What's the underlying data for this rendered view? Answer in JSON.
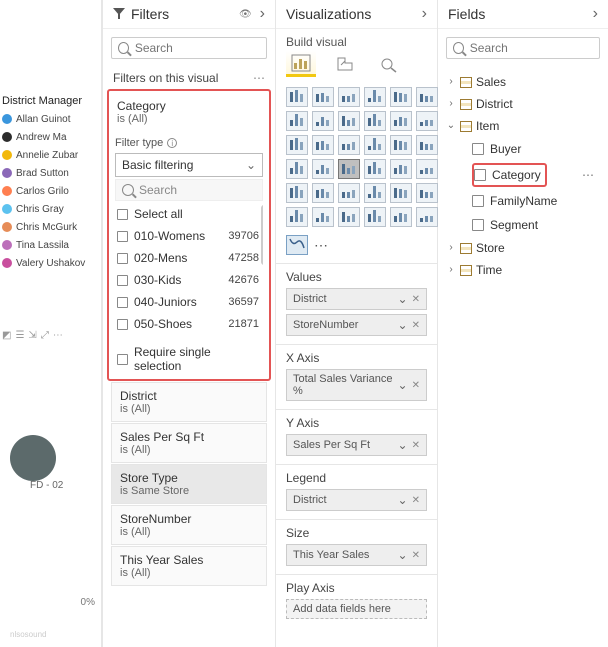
{
  "canvas": {
    "title": "District Manager",
    "legend": [
      {
        "name": "Allan Guinot",
        "color": "#3a96dd"
      },
      {
        "name": "Andrew Ma",
        "color": "#2c2c2c"
      },
      {
        "name": "Annelie Zubar",
        "color": "#f2b80b"
      },
      {
        "name": "Brad Sutton",
        "color": "#8b68b8"
      },
      {
        "name": "Carlos Grilo",
        "color": "#ff7f50"
      },
      {
        "name": "Chris Gray",
        "color": "#5cc2ef"
      },
      {
        "name": "Chris McGurk",
        "color": "#e68c57"
      },
      {
        "name": "Tina Lassila",
        "color": "#bc6fba"
      },
      {
        "name": "Valery Ushakov",
        "color": "#c94f9e"
      }
    ],
    "bubble_label": "FD - 02",
    "pct_axis": "0%",
    "cube": "nlsosound"
  },
  "filters": {
    "title": "Filters",
    "search_placeholder": "Search",
    "section": "Filters on this visual",
    "category": {
      "title": "Category",
      "sub": "is (All)",
      "type_label": "Filter type",
      "type_value": "Basic filtering",
      "search": "Search",
      "options": [
        {
          "label": "Select all",
          "count": ""
        },
        {
          "label": "010-Womens",
          "count": "39706"
        },
        {
          "label": "020-Mens",
          "count": "47258"
        },
        {
          "label": "030-Kids",
          "count": "42676"
        },
        {
          "label": "040-Juniors",
          "count": "36597"
        },
        {
          "label": "050-Shoes",
          "count": "21871"
        }
      ],
      "require": "Require single selection"
    },
    "cards": [
      {
        "title": "District",
        "sub": "is (All)"
      },
      {
        "title": "Sales Per Sq Ft",
        "sub": "is (All)"
      },
      {
        "title": "Store Type",
        "sub": "is Same Store",
        "selected": true
      },
      {
        "title": "StoreNumber",
        "sub": "is (All)"
      },
      {
        "title": "This Year Sales",
        "sub": "is (All)"
      }
    ]
  },
  "viz": {
    "title": "Visualizations",
    "sub": "Build visual",
    "wells": {
      "values": {
        "label": "Values",
        "items": [
          "District",
          "StoreNumber"
        ]
      },
      "xaxis": {
        "label": "X Axis",
        "items": [
          "Total Sales Variance %"
        ]
      },
      "yaxis": {
        "label": "Y Axis",
        "items": [
          "Sales Per Sq Ft"
        ]
      },
      "legend": {
        "label": "Legend",
        "items": [
          "District"
        ]
      },
      "size": {
        "label": "Size",
        "items": [
          "This Year Sales"
        ]
      },
      "play": {
        "label": "Play Axis",
        "items": []
      },
      "addhint": "Add data fields here"
    }
  },
  "fields": {
    "title": "Fields",
    "search_placeholder": "Search",
    "tables": [
      {
        "name": "Sales",
        "expanded": false
      },
      {
        "name": "District",
        "expanded": false
      },
      {
        "name": "Item",
        "expanded": true,
        "children": [
          "Buyer",
          "Category",
          "FamilyName",
          "Segment"
        ]
      },
      {
        "name": "Store",
        "expanded": false
      },
      {
        "name": "Time",
        "expanded": false
      }
    ],
    "highlight": "Category"
  }
}
